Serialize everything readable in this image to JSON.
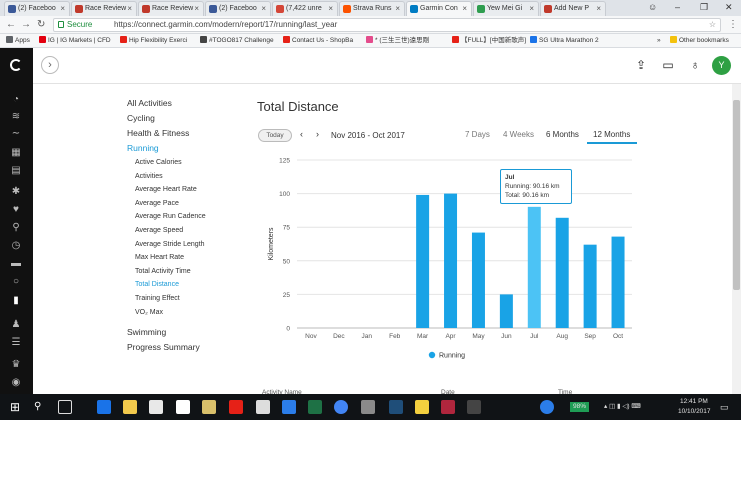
{
  "browser": {
    "tabs": [
      {
        "title": "(2) Faceboo",
        "color": "#3b5998"
      },
      {
        "title": "Race Review",
        "color": "#c0392b"
      },
      {
        "title": "Race Review",
        "color": "#c0392b"
      },
      {
        "title": "(2) Faceboo",
        "color": "#3b5998"
      },
      {
        "title": "(7,422 unre",
        "color": "#d44638"
      },
      {
        "title": "Strava Runs",
        "color": "#fc5200"
      },
      {
        "title": "Garmin Con",
        "color": "#007cc3"
      },
      {
        "title": "Yew Mei Gi",
        "color": "#2e9d4f"
      },
      {
        "title": "Add New P",
        "color": "#c0392b"
      }
    ],
    "window_controls": [
      "☺",
      "–",
      "❐",
      "✕"
    ],
    "secure_label": "Secure",
    "url": "https://connect.garmin.com/modern/report/17/running/last_year",
    "star": "☆",
    "bookmarks": [
      {
        "label": "Apps",
        "color": "#5f6368"
      },
      {
        "label": "IG | IG Markets | CFD",
        "color": "#e3000f"
      },
      {
        "label": "Hip Flexibility Exerci",
        "color": "#e62117"
      },
      {
        "label": "#TOGO817 Challenge",
        "color": "#444444"
      },
      {
        "label": "Contact Us - ShopBa",
        "color": "#e62117"
      },
      {
        "label": "* (三生三世)遠思剛",
        "color": "#e44c8c"
      },
      {
        "label": "【FULL】[中国新歌声]",
        "color": "#e62117"
      },
      {
        "label": "SG Ultra Marathon 2",
        "color": "#1a73e8"
      }
    ],
    "bookmarks_more": "»",
    "other_bookmarks": "Other bookmarks"
  },
  "header": {
    "expand_glyph": "›",
    "avatar_letter": "Y"
  },
  "menu": {
    "items_top": [
      "All Activities",
      "Cycling",
      "Health & Fitness",
      "Running"
    ],
    "subitems": [
      "Active Calories",
      "Activities",
      "Average Heart Rate",
      "Average Pace",
      "Average Run Cadence",
      "Average Speed",
      "Average Stride Length",
      "Max Heart Rate",
      "Total Activity Time",
      "Total Distance",
      "Training Effect",
      "VO₂ Max"
    ],
    "items_bottom": [
      "Swimming",
      "Progress Summary"
    ],
    "active_subitem_index": 9
  },
  "report": {
    "title": "Total Distance",
    "today_label": "Today",
    "prev_glyph": "‹",
    "next_glyph": "›",
    "date_range": "Nov 2016 - Oct 2017",
    "range_tabs": [
      "7 Days",
      "4 Weeks",
      "6 Months",
      "12 Months"
    ],
    "active_range_index": 3
  },
  "tooltip": {
    "month": "Jul",
    "running": "Running: 90.16 km",
    "total": "Total: 90.16 km"
  },
  "chart_data": {
    "type": "bar",
    "ylabel": "Kilometers",
    "ylim": [
      0,
      125
    ],
    "yticks": [
      0,
      25,
      50,
      75,
      100,
      125
    ],
    "categories": [
      "Nov",
      "Dec",
      "Jan",
      "Feb",
      "Mar",
      "Apr",
      "May",
      "Jun",
      "Jul",
      "Aug",
      "Sep",
      "Oct"
    ],
    "series": [
      {
        "name": "Running",
        "values": [
          0,
          0,
          0,
          0,
          99,
          100,
          71,
          25,
          90.16,
          82,
          62,
          68
        ]
      }
    ],
    "highlight_index": 8,
    "legend_position": "bottom",
    "grid": true,
    "colors": {
      "bar": "#19a3e6",
      "highlight": "#4cc3f5",
      "grid": "#e4e4e4"
    }
  },
  "table_headers": [
    "Activity Name",
    "Date",
    "Time"
  ],
  "taskbar": {
    "battery": "98%",
    "time": "12:41 PM",
    "date": "10/10/2017"
  }
}
